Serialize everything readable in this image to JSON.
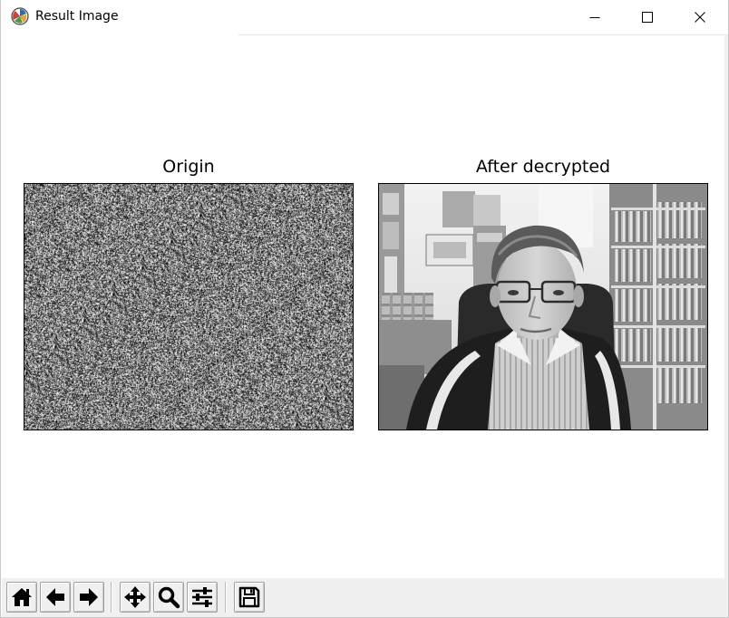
{
  "window": {
    "title": "Result Image",
    "app_icon": "matplotlib-icon",
    "controls": [
      "minimize-icon",
      "maximize-icon",
      "close-icon"
    ]
  },
  "figure": {
    "subplots": [
      {
        "title": "Origin",
        "content": "noise image"
      },
      {
        "title": "After decrypted",
        "content": "grayscale photo"
      }
    ]
  },
  "toolbar": {
    "buttons": [
      {
        "icon": "home-icon"
      },
      {
        "icon": "back-arrow-icon"
      },
      {
        "icon": "forward-arrow-icon"
      },
      {
        "icon": "pan-icon"
      },
      {
        "icon": "zoom-icon"
      },
      {
        "icon": "configure-subplots-icon"
      },
      {
        "icon": "save-icon"
      }
    ]
  }
}
